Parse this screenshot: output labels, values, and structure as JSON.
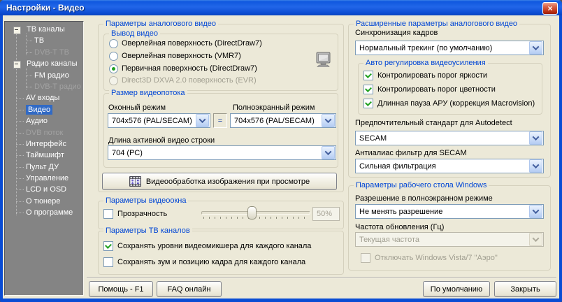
{
  "window": {
    "title": "Настройки - Видео",
    "close_glyph": "×"
  },
  "colors": {
    "titlebar_blue": "#1058DF",
    "selection_blue": "#316AC5",
    "group_label_blue": "#0046D5",
    "check_green": "#21A121",
    "sidebar_gray": "#848484",
    "dialog_bg": "#ECE9D8"
  },
  "sidebar": {
    "items": [
      {
        "label": "ТВ каналы"
      },
      {
        "label": "ТВ"
      },
      {
        "label": "DVB-T ТВ"
      },
      {
        "label": "Радио каналы"
      },
      {
        "label": "FM радио"
      },
      {
        "label": "DVB-T радио"
      },
      {
        "label": "AV входы"
      },
      {
        "label": "Видео"
      },
      {
        "label": "Аудио"
      },
      {
        "label": "DVB поток"
      },
      {
        "label": "Интерфейс"
      },
      {
        "label": "Таймшифт"
      },
      {
        "label": "Пульт ДУ"
      },
      {
        "label": "Управление"
      },
      {
        "label": "LCD и OSD"
      },
      {
        "label": "О тюнере"
      },
      {
        "label": "О программе"
      }
    ]
  },
  "analog_video": {
    "title": "Параметры аналогового видео",
    "output_group": {
      "title": "Вывод видео",
      "options": [
        {
          "label": "Оверлейная поверхность (DirectDraw7)"
        },
        {
          "label": "Оверлейная поверхность (VMR7)"
        },
        {
          "label": "Первичная поверхность (DirectDraw7)"
        },
        {
          "label": "Direct3D DXVA 2.0 поверхность (EVR)"
        }
      ]
    },
    "stream_size_group": {
      "title": "Размер видеопотока",
      "windowed_label": "Оконный режим",
      "fullscreen_label": "Полноэкранный режим",
      "windowed_value": "704x576 (PAL/SECAM)",
      "equals": "=",
      "fullscreen_value": "704x576 (PAL/SECAM)",
      "line_length_label": "Длина активной видео строки",
      "line_length_value": "704 (РС)"
    },
    "processing_button": "Видеообработка изображения при просмотре"
  },
  "video_window": {
    "title": "Параметры видеоокна",
    "transparency_label": "Прозрачность",
    "transparency_value": "50%"
  },
  "tv_channels": {
    "title": "Параметры ТВ каналов",
    "save_mixer": "Сохранять уровни видеомикшера для каждого канала",
    "save_zoom": "Сохранять зум и позицию кадра для каждого канала"
  },
  "advanced": {
    "title": "Расширенные параметры аналогового видео",
    "sync_label": "Синхронизация кадров",
    "sync_value": "Нормальный трекинг (по умолчанию)",
    "agc_group": {
      "title": "Авто регулировка видеоусиления",
      "items": [
        {
          "label": "Контролировать порог яркости"
        },
        {
          "label": "Контролировать порог цветности"
        },
        {
          "label": "Длинная пауза АРУ (коррекция Macrovision)"
        }
      ]
    },
    "standard_label": "Предпочтительный стандарт для Autodetect",
    "standard_value": "SECAM",
    "antialias_label": "Антиалиас фильтр для SECAM",
    "antialias_value": "Сильная фильтрация"
  },
  "desktop": {
    "title": "Параметры рабочего стола Windows",
    "resolution_label": "Разрешение в полноэкранном режиме",
    "resolution_value": "Не менять разрешение",
    "refresh_label": "Частота обновления (Гц)",
    "refresh_value": "Текущая частота",
    "aero_label": "Отключать Windows Vista/7 \"Аэро\""
  },
  "footer": {
    "help": "Помощь - F1",
    "faq": "FAQ онлайн",
    "defaults": "По умолчанию",
    "close": "Закрыть"
  }
}
